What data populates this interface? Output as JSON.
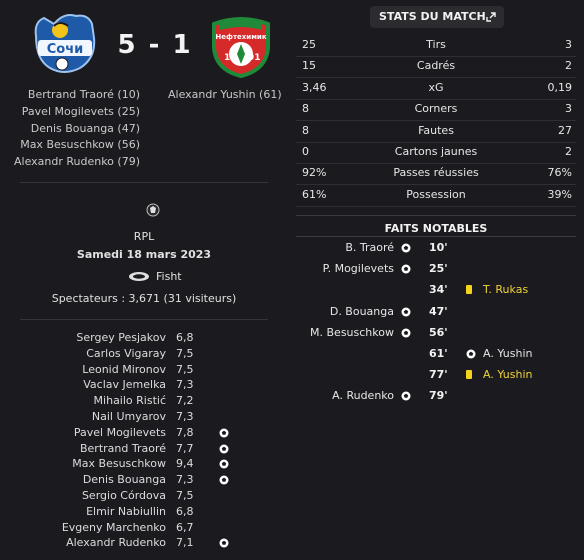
{
  "header": {
    "home_team": "Сочи",
    "away_team": "Нефтехимик",
    "away_crest_year_left": "19",
    "away_crest_year_right": "91",
    "score": "5 - 1",
    "home_scorers": [
      "Bertrand Traoré (10)",
      "Pavel Mogilevets (25)",
      "Denis Bouanga (47)",
      "Max Besuschkow (56)",
      "Alexandr Rudenko (79)"
    ],
    "away_scorers": [
      "Alexandr Yushin (61)"
    ]
  },
  "match_info": {
    "competition": "RPL",
    "date": "Samedi 18 mars 2023",
    "stadium": "Fisht",
    "attendance": "Spectateurs : 3,671 (31 visiteurs)"
  },
  "ratings": [
    {
      "name": "Sergey Pesjakov",
      "rating": "6,8",
      "goal": false
    },
    {
      "name": "Carlos Vigaray",
      "rating": "7,5",
      "goal": false
    },
    {
      "name": "Leonid Mironov",
      "rating": "7,5",
      "goal": false
    },
    {
      "name": "Vaclav Jemelka",
      "rating": "7,3",
      "goal": false
    },
    {
      "name": "Mihailo Ristić",
      "rating": "7,2",
      "goal": false
    },
    {
      "name": "Nail Umyarov",
      "rating": "7,3",
      "goal": false
    },
    {
      "name": "Pavel Mogilevets",
      "rating": "7,8",
      "goal": true
    },
    {
      "name": "Bertrand Traoré",
      "rating": "7,7",
      "goal": true
    },
    {
      "name": "Max Besuschkow",
      "rating": "9,4",
      "goal": true
    },
    {
      "name": "Denis Bouanga",
      "rating": "7,3",
      "goal": true
    },
    {
      "name": "Sergio Córdova",
      "rating": "7,5",
      "goal": false
    },
    {
      "name": "Elmir Nabiullin",
      "rating": "6,8",
      "goal": false
    },
    {
      "name": "Evgeny Marchenko",
      "rating": "6,7",
      "goal": false
    },
    {
      "name": "Alexandr Rudenko",
      "rating": "7,1",
      "goal": true
    }
  ],
  "stats": {
    "button_label": "STATS DU MATCH",
    "rows": [
      {
        "home": "25",
        "label": "Tirs",
        "away": "3"
      },
      {
        "home": "15",
        "label": "Cadrés",
        "away": "2"
      },
      {
        "home": "3,46",
        "label": "xG",
        "away": "0,19"
      },
      {
        "home": "8",
        "label": "Corners",
        "away": "3"
      },
      {
        "home": "8",
        "label": "Fautes",
        "away": "27"
      },
      {
        "home": "0",
        "label": "Cartons jaunes",
        "away": "2"
      },
      {
        "home": "92%",
        "label": "Passes réussies",
        "away": "76%"
      },
      {
        "home": "61%",
        "label": "Possession",
        "away": "39%"
      }
    ]
  },
  "facts": {
    "title": "FAITS NOTABLES",
    "events": [
      {
        "home": "B. Traoré",
        "home_icon": "ball",
        "minute": "10'",
        "away": "",
        "away_icon": ""
      },
      {
        "home": "P. Mogilevets",
        "home_icon": "ball",
        "minute": "25'",
        "away": "",
        "away_icon": ""
      },
      {
        "home": "",
        "home_icon": "",
        "minute": "34'",
        "away": "T. Rukas",
        "away_icon": "yellow-card"
      },
      {
        "home": "D. Bouanga",
        "home_icon": "ball",
        "minute": "47'",
        "away": "",
        "away_icon": ""
      },
      {
        "home": "M. Besuschkow",
        "home_icon": "ball",
        "minute": "56'",
        "away": "",
        "away_icon": ""
      },
      {
        "home": "",
        "home_icon": "",
        "minute": "61'",
        "away": "A. Yushin",
        "away_icon": "ball"
      },
      {
        "home": "",
        "home_icon": "",
        "minute": "77'",
        "away": "A. Yushin",
        "away_icon": "yellow-card",
        "away_highlight": true
      },
      {
        "home": "A. Rudenko",
        "home_icon": "ball",
        "minute": "79'",
        "away": "",
        "away_icon": ""
      }
    ]
  },
  "colors": {
    "background": "#1b1b1f",
    "yellow_card": "#f3d31c",
    "highlight_text": "#f0d33a",
    "home_crest_blue": "#1f5aa8",
    "away_crest_red": "#d62a2a",
    "away_crest_green": "#1f8a3a"
  }
}
